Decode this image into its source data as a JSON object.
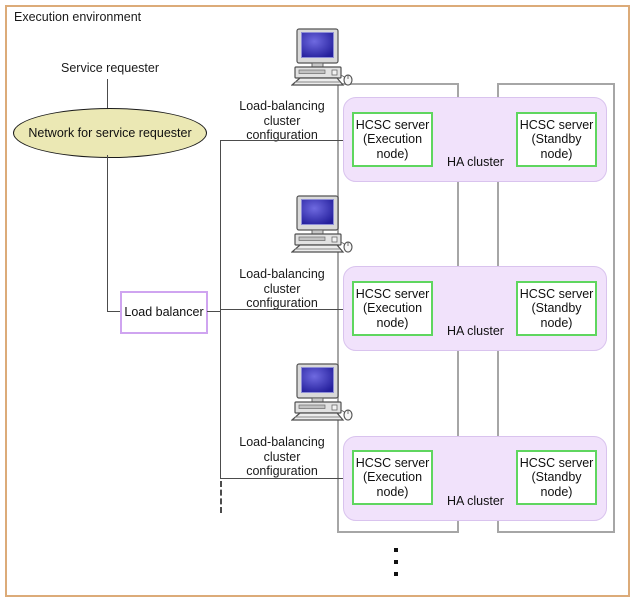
{
  "diagram": {
    "title": "Execution environment",
    "service_requester_label": "Service requester",
    "network_oval_label": "Network for service requester",
    "load_balancer_label": "Load\nbalancer",
    "lb_cluster_label": "Load-balancing\ncluster\nconfiguration",
    "ha_cluster_label": "HA cluster",
    "execution_node_label": "HCSC server\n(Execution\nnode)",
    "standby_node_label": "HCSC server\n(Standby\nnode)",
    "continuation_marker": "vertical-ellipsis",
    "rows": [
      {
        "id": "row-1",
        "lb_cluster_label": "Load-balancing\ncluster\nconfiguration",
        "ha_cluster_label": "HA cluster",
        "execution_node_label": "HCSC server\n(Execution\nnode)",
        "standby_node_label": "HCSC server\n(Standby\nnode)",
        "computer_icon": "desktop-computer-icon"
      },
      {
        "id": "row-2",
        "lb_cluster_label": "Load-balancing\ncluster\nconfiguration",
        "ha_cluster_label": "HA cluster",
        "execution_node_label": "HCSC server\n(Execution\nnode)",
        "standby_node_label": "HCSC server\n(Standby\nnode)",
        "computer_icon": "desktop-computer-icon"
      },
      {
        "id": "row-3",
        "lb_cluster_label": "Load-balancing\ncluster\nconfiguration",
        "ha_cluster_label": "HA cluster",
        "execution_node_label": "HCSC server\n(Execution\nnode)",
        "standby_node_label": "HCSC server\n(Standby\nnode)",
        "computer_icon": "desktop-computer-icon"
      }
    ],
    "columns": {
      "execution_column": "Execution node column",
      "standby_column": "Standby node column"
    },
    "colors": {
      "frame_border": "#dcab79",
      "oval_fill": "#ebe8b4",
      "oval_border": "#1c1c1c",
      "ha_cluster_fill": "#f1e2fb",
      "ha_cluster_border": "#d9c3ee",
      "server_border": "#5fd65f",
      "load_balancer_border": "#cfa4f0",
      "column_border": "#a6a6a6",
      "line": "#4c4c4c",
      "text": "#101010",
      "monitor_screen": "#3a34c8"
    }
  }
}
